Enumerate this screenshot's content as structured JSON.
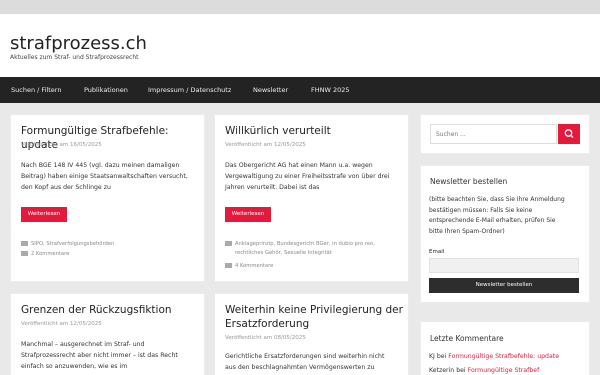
{
  "site": {
    "title": "strafprozess.ch",
    "description": "Aktuelles zum Straf- und Strafprozessrecht"
  },
  "nav": {
    "items": [
      "Suchen / Filtern",
      "Publikationen",
      "Impressum / Datenschutz",
      "Newsletter",
      "FHNW 2025"
    ]
  },
  "posts": [
    {
      "title": "Formungültige Strafbefehle: update",
      "date": "Veröffentlicht am 16/05/2025",
      "excerpt": [
        "Nach BGE 148 IV 445 (vgl. dazu meinen damaligen",
        "Beitrag) haben einige Staatsanwaltschaften versucht,",
        "den Kopf aus der Schlinge zu"
      ],
      "button": "Weiterlesen",
      "tags": "SIPO, Strafverfolgungsbehörden",
      "comments": "2 Kommentare"
    },
    {
      "title": "Willkürlich verurteilt",
      "date": "Veröffentlicht am 12/05/2025",
      "excerpt": [
        "Das Obergericht AG hat einen Mann u.a. wegen",
        "Vergewaltigung zu einer Freiheitsstrafe von über drei",
        "Jahren verurteilt. Dabei ist das"
      ],
      "button": "Weiterlesen",
      "tags": [
        "Anklageprinzip, Bundesgericht BGer, in dubio pro reo,",
        "rechtliches Gehör, Sexuelle Integrität"
      ],
      "comments": "4 Kommentare"
    },
    {
      "title": "Grenzen der Rückzugsfiktion",
      "date": "Veröffentlicht am 12/05/2025",
      "excerpt": [
        "Manchmal – ausgerechnet im Straf- und",
        "Strafprozessrecht aber nicht immer – ist das Recht",
        "einfach so anzuwenden, wie es im"
      ]
    },
    {
      "title": "Weiterhin keine Privilegierung der Ersatzforderung",
      "title_lines": [
        "Weiterhin keine Privilegierung der",
        "Ersatzforderung"
      ],
      "date": "Veröffentlicht am 08/05/2025",
      "excerpt": [
        "Gerichtliche Ersatzforderungen sind weiterhin nicht",
        "aus den beschlagnahmten Vermögenswerten zu"
      ]
    }
  ],
  "sidebar": {
    "search_placeholder": "Suchen ...",
    "newsletter": {
      "title": "Newsletter bestellen",
      "text": [
        "(bitte beachten Sie, dass Sie Ihre Anmeldung",
        "bestätigen müssen: Falls Sie keine",
        "entsprechende E-Mail erhalten, prüfen Sie",
        "bitte Ihren Spam-Ordner)"
      ],
      "email_label": "Email",
      "button": "Newsletter bestellen"
    },
    "comments": {
      "title": "Letzte Kommentare",
      "items": [
        {
          "author": "KJ",
          "sep": " bei ",
          "post": "Formungültige Strafbefehle: update"
        },
        {
          "author": "Ketzerin",
          "sep": " bei ",
          "post": "Formungültige Strafbef"
        }
      ]
    }
  },
  "colors": {
    "accent": "#e5193b",
    "nav_bg": "#232323",
    "page_bg": "#e9e9e9"
  }
}
